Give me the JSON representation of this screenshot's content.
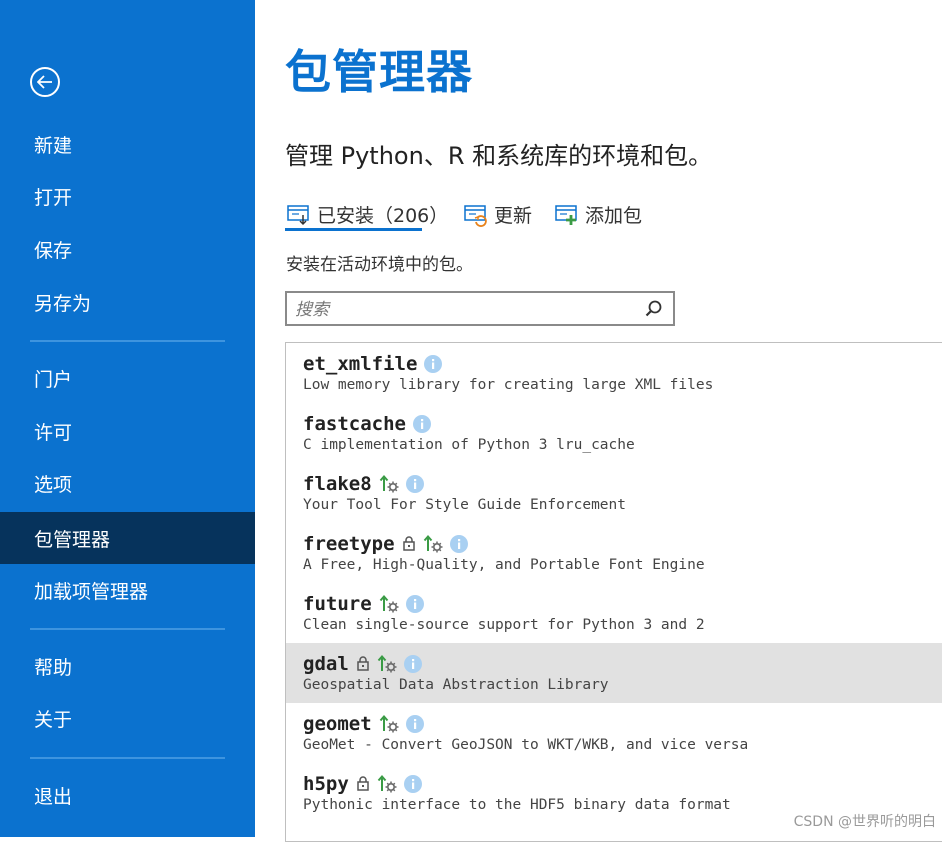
{
  "sidebar": {
    "items": [
      {
        "label": "新建",
        "name": "nav-new"
      },
      {
        "label": "打开",
        "name": "nav-open"
      },
      {
        "label": "保存",
        "name": "nav-save"
      },
      {
        "label": "另存为",
        "name": "nav-save-as"
      },
      {
        "label": "门户",
        "name": "nav-portal"
      },
      {
        "label": "许可",
        "name": "nav-licensing"
      },
      {
        "label": "选项",
        "name": "nav-options"
      },
      {
        "label": "包管理器",
        "name": "nav-package-manager",
        "active": true
      },
      {
        "label": "加载项管理器",
        "name": "nav-addin-manager"
      },
      {
        "label": "帮助",
        "name": "nav-help"
      },
      {
        "label": "关于",
        "name": "nav-about"
      },
      {
        "label": "退出",
        "name": "nav-exit"
      }
    ]
  },
  "main": {
    "title": "包管理器",
    "subtitle": "管理 Python、R 和系统库的环境和包。",
    "tabs": [
      {
        "label": "已安装（206）",
        "icon": "installed-icon",
        "active": true
      },
      {
        "label": "更新",
        "icon": "update-icon"
      },
      {
        "label": "添加包",
        "icon": "add-package-icon"
      }
    ],
    "description": "安装在活动环境中的包。",
    "search": {
      "placeholder": "搜索",
      "value": ""
    }
  },
  "packages": [
    {
      "name": "et_xmlfile",
      "desc": "Low memory library for creating large XML files",
      "locked": false,
      "updatable": false
    },
    {
      "name": "fastcache",
      "desc": "C implementation of Python 3 lru_cache",
      "locked": false,
      "updatable": false
    },
    {
      "name": "flake8",
      "desc": "Your Tool For Style Guide Enforcement",
      "locked": false,
      "updatable": true
    },
    {
      "name": "freetype",
      "desc": "A Free, High-Quality, and Portable Font Engine",
      "locked": true,
      "updatable": true
    },
    {
      "name": "future",
      "desc": "Clean single-source support for Python 3 and 2",
      "locked": false,
      "updatable": true
    },
    {
      "name": "gdal",
      "desc": "Geospatial Data Abstraction Library",
      "locked": true,
      "updatable": true,
      "selected": true
    },
    {
      "name": "geomet",
      "desc": "GeoMet - Convert GeoJSON to WKT/WKB, and vice versa",
      "locked": false,
      "updatable": true
    },
    {
      "name": "h5py",
      "desc": "Pythonic interface to the HDF5 binary data format",
      "locked": true,
      "updatable": true
    },
    {
      "name": "...",
      "desc": "",
      "locked": false,
      "updatable": false
    }
  ],
  "watermark": "CSDN @世界听的明白",
  "colors": {
    "accent": "#0b72cf",
    "sidebar_active": "#06335c",
    "info": "#a9d0f2",
    "update_green": "#3a9b45"
  }
}
